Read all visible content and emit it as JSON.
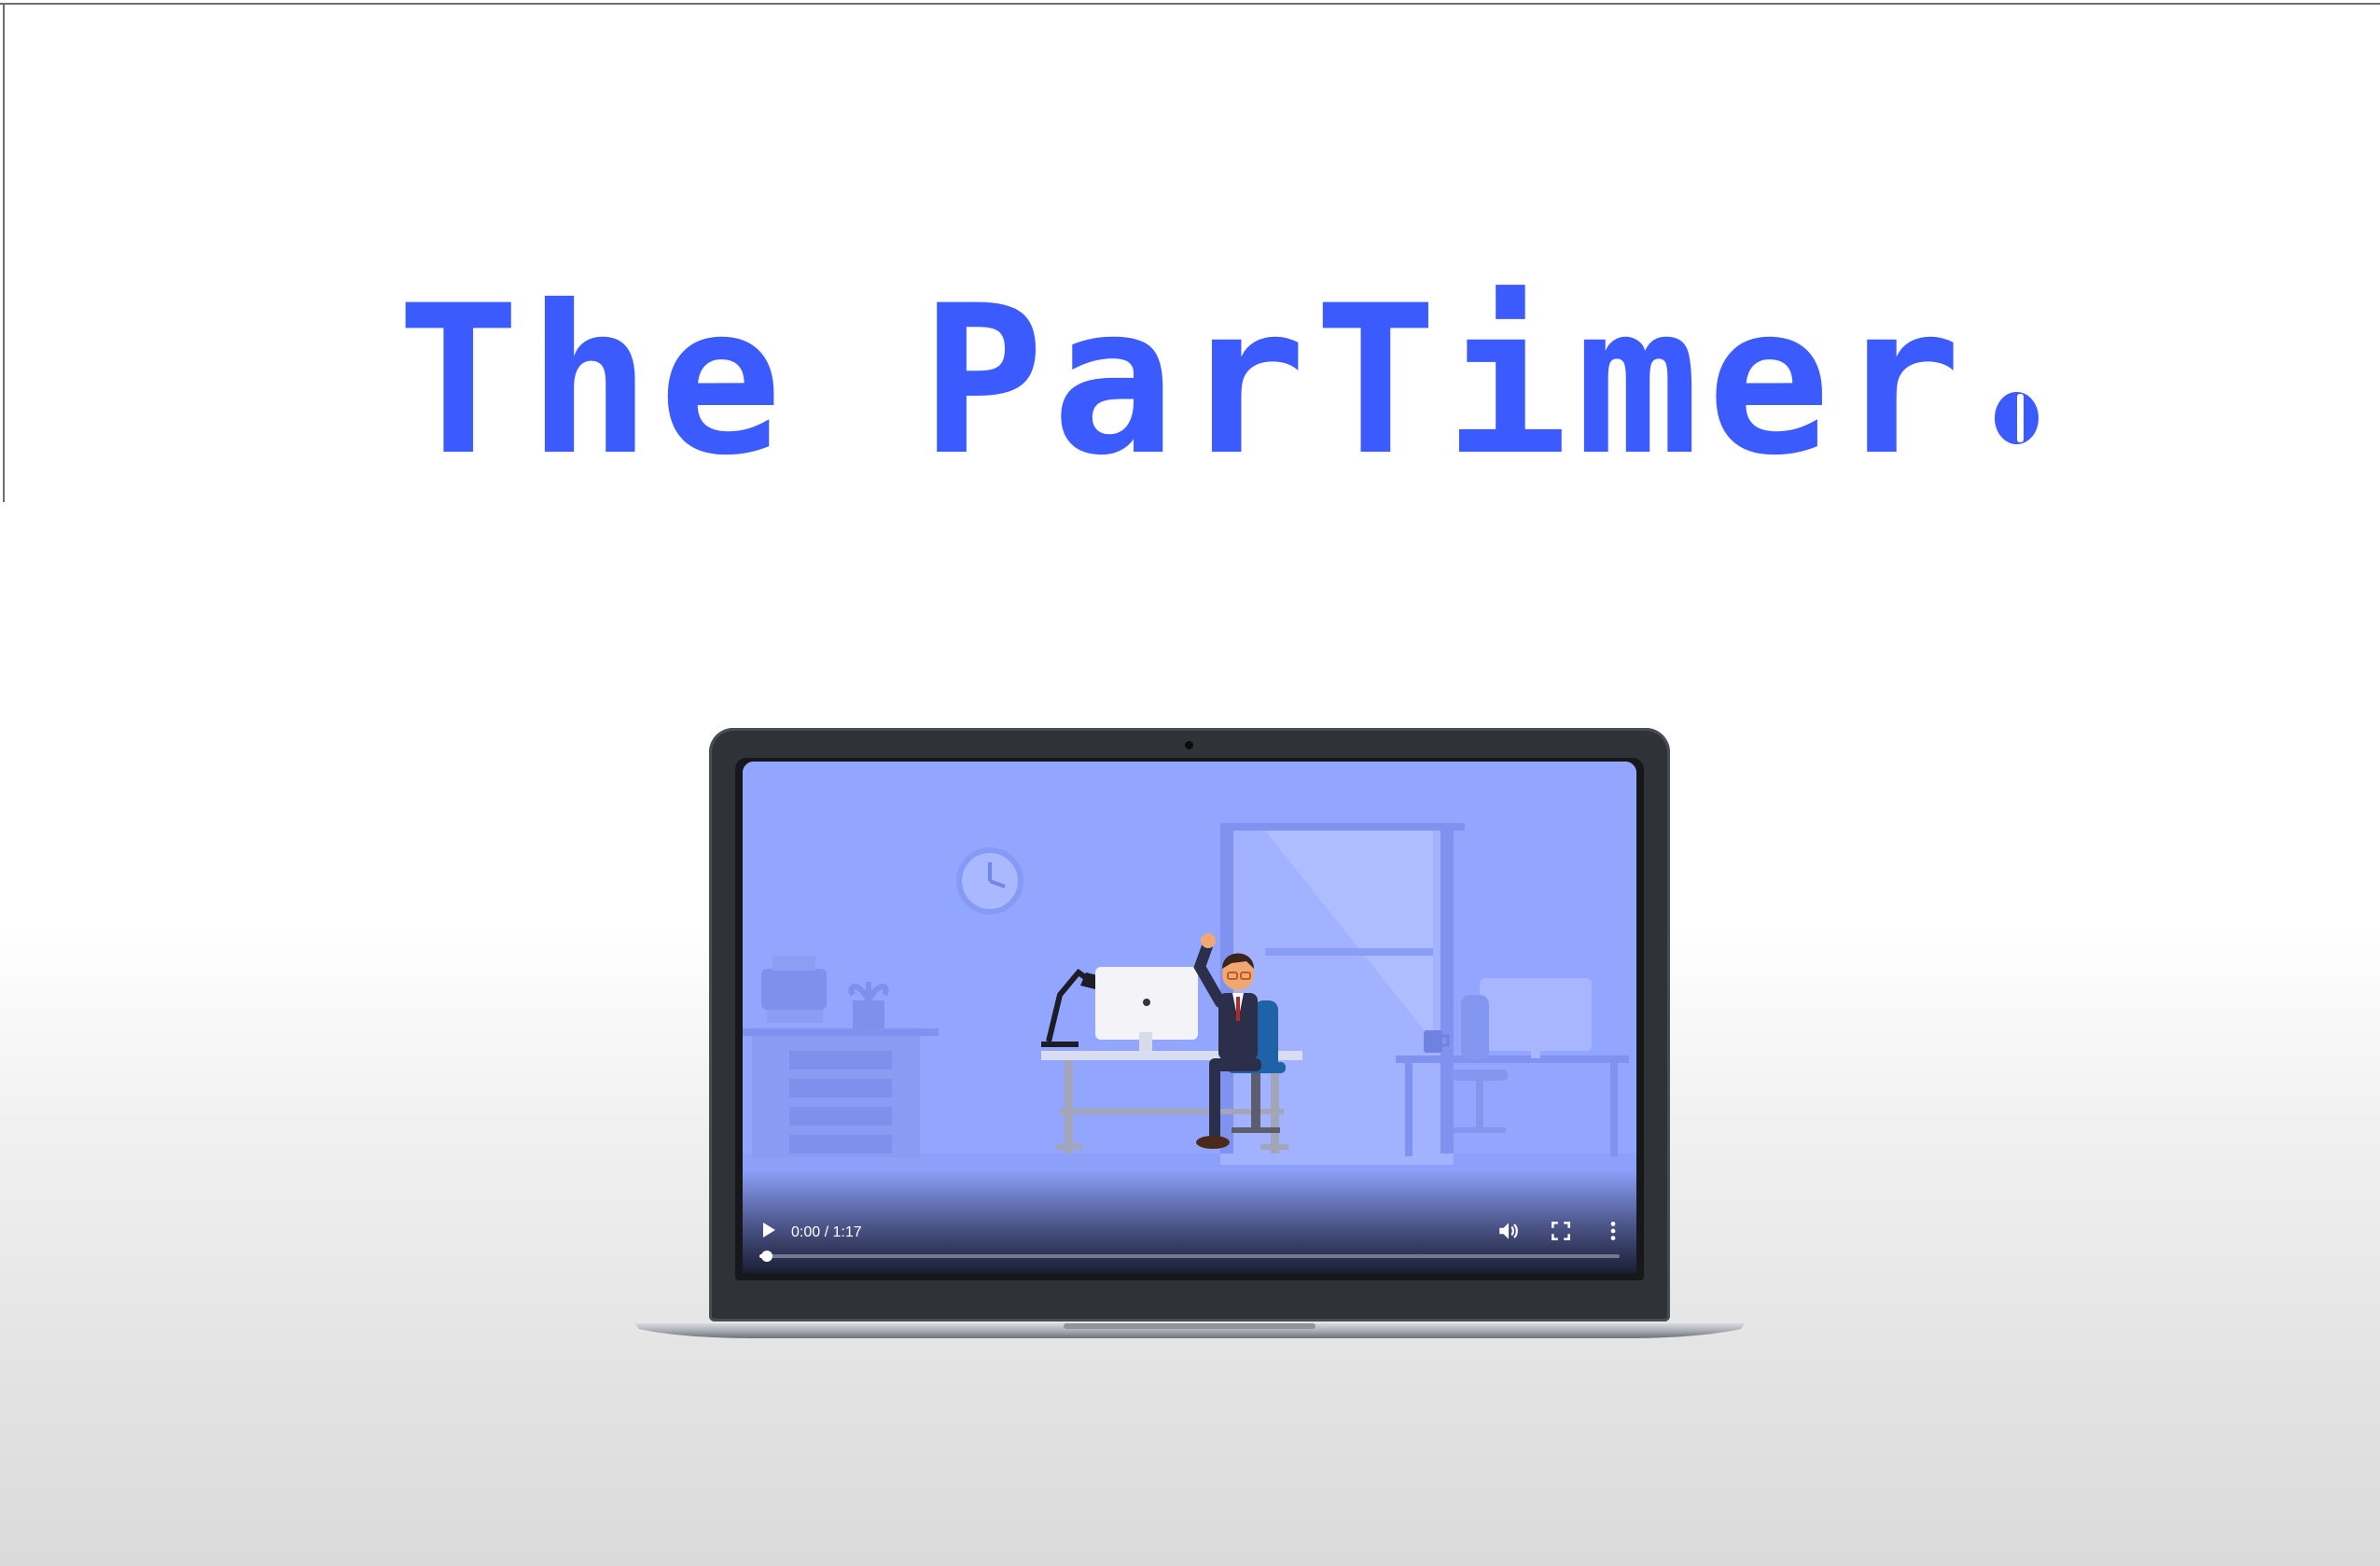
{
  "brand": {
    "logo_text": "The ParTimer",
    "logo_color": "#3b5bff"
  },
  "video_player": {
    "current_time": "0:00",
    "duration": "1:17",
    "time_display": "0:00 / 1:17",
    "progress_fraction": 0.0,
    "play_icon": "play-icon",
    "volume_icon": "volume-icon",
    "fullscreen_icon": "fullscreen-icon",
    "more_icon": "more-options-icon"
  },
  "scene": {
    "background_color": "#93a6ff",
    "description_icons": [
      "clock-icon",
      "window-icon",
      "printer-icon",
      "plant-icon",
      "desk-lamp-icon",
      "monitor-icon",
      "office-chair-icon",
      "coffee-mug-icon"
    ]
  }
}
